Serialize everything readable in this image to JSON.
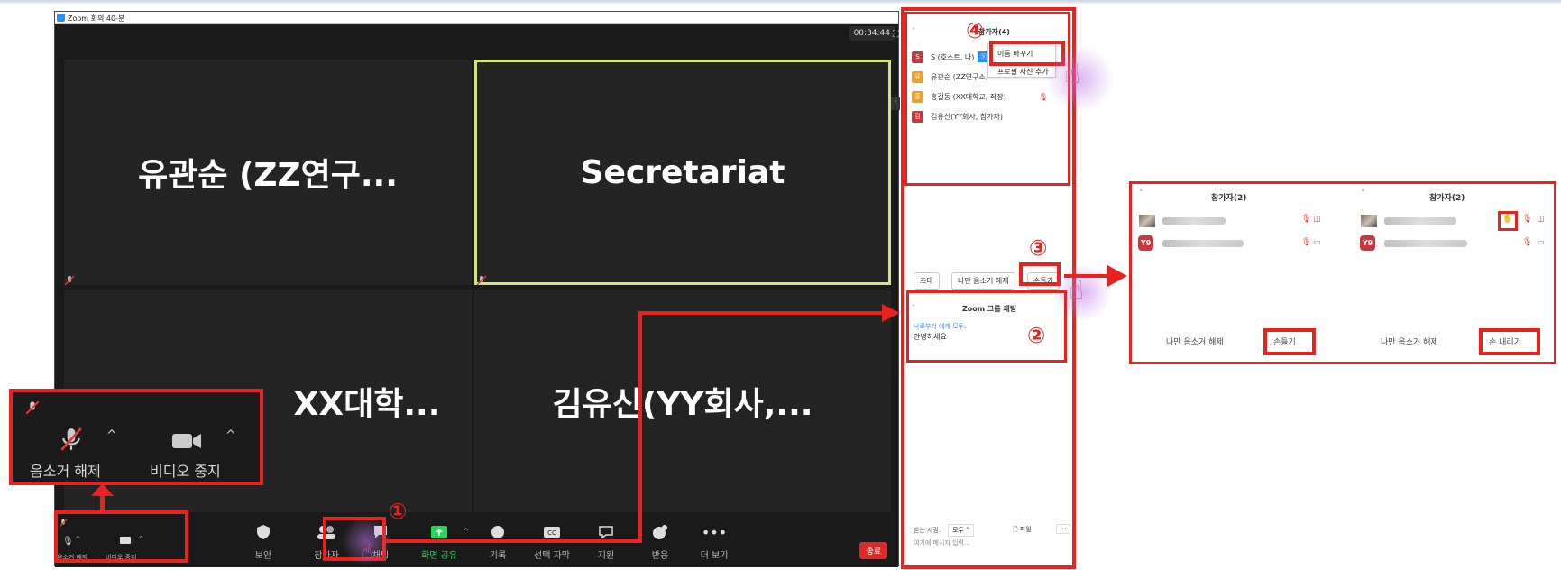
{
  "window": {
    "title": "Zoom 회의 40-분",
    "timer": "00:34:44"
  },
  "tiles": [
    {
      "name": "유관순 (ZZ연구..."
    },
    {
      "name": "Secretariat"
    },
    {
      "name": "XX대학..."
    },
    {
      "name": "김유신(YY회사,..."
    }
  ],
  "toolbar": {
    "unmute": "음소거 해제",
    "stop_video": "비디오 중지",
    "security": "보안",
    "participants": "참가자",
    "chat": "채팅",
    "share": "화면 공유",
    "record": "기록",
    "cc": "선택 자막",
    "support": "지원",
    "reactions": "반응",
    "more": "더 보기",
    "end": "종료",
    "colors": {
      "share": "#23d959",
      "end": "#e02828"
    }
  },
  "callout": {
    "unmute": "음소거 해제",
    "stop_video": "비디오 중지"
  },
  "steps": [
    "①",
    "②",
    "③",
    "④"
  ],
  "panel": {
    "header": "참가자(4)",
    "participants": [
      {
        "initial": "S",
        "name": "S (호스트, 나)",
        "color": "#c8373c"
      },
      {
        "initial": "유",
        "name": "유관순 (ZZ연구소,",
        "color": "#f0a020"
      },
      {
        "initial": "홍",
        "name": "홍길동 (XX대학교, 좌장)",
        "color": "#f0a020"
      },
      {
        "initial": "김",
        "name": "김유신(YY회사, 참가자)",
        "color": "#c8373c"
      }
    ],
    "context_menu": {
      "rename": "이름 바꾸기",
      "profile_picture": "프로필 사진 추가"
    },
    "invite": "초대",
    "unmute_me": "나만 음소거 해제",
    "raise_hand": "손들기",
    "chat_title": "Zoom 그룹 채팅",
    "chat_from": "나로부터 에게 모두:",
    "chat_message": "안녕하세요",
    "recipient_label": "받는 사람:",
    "recipient_value": "모두",
    "file": "파일",
    "input_placeholder": "여기에 메시지 입력..."
  },
  "example": {
    "left": {
      "title": "참가자(2)",
      "unmute_me": "나만 음소거 해제",
      "hand": "손들기"
    },
    "right": {
      "title": "참가자(2)",
      "unmute_me": "나만 음소거 해제",
      "hand": "손 내리기"
    },
    "y9_label": "Y9"
  }
}
